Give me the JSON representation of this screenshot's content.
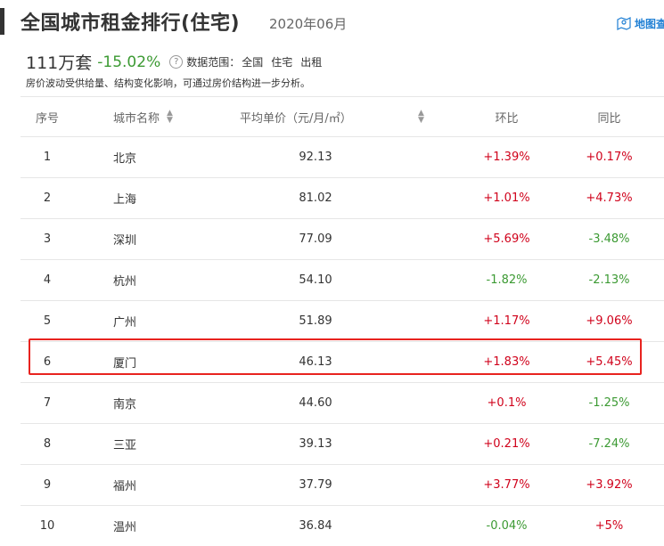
{
  "header": {
    "title": "全国城市租金排行(住宅)",
    "date": "2020年06月",
    "map_link": "地图查"
  },
  "summary": {
    "total": "111万套",
    "change": "-15.02%",
    "help_icon": "?",
    "scope_label": "数据范围：",
    "scope_region": "全国",
    "scope_type": "住宅",
    "scope_mode": "出租",
    "note": "房价波动受供给量、结构变化影响，可通过房价结构进一步分析。"
  },
  "table": {
    "columns": {
      "rank": "序号",
      "city": "城市名称",
      "price": "平均单价（元/月/㎡）",
      "mom": "环比",
      "yoy": "同比"
    },
    "rows": [
      {
        "rank": "1",
        "city": "北京",
        "price": "92.13",
        "mom": "+1.39%",
        "yoy": "+0.17%"
      },
      {
        "rank": "2",
        "city": "上海",
        "price": "81.02",
        "mom": "+1.01%",
        "yoy": "+4.73%"
      },
      {
        "rank": "3",
        "city": "深圳",
        "price": "77.09",
        "mom": "+5.69%",
        "yoy": "-3.48%"
      },
      {
        "rank": "4",
        "city": "杭州",
        "price": "54.10",
        "mom": "-1.82%",
        "yoy": "-2.13%"
      },
      {
        "rank": "5",
        "city": "广州",
        "price": "51.89",
        "mom": "+1.17%",
        "yoy": "+9.06%"
      },
      {
        "rank": "6",
        "city": "厦门",
        "price": "46.13",
        "mom": "+1.83%",
        "yoy": "+5.45%"
      },
      {
        "rank": "7",
        "city": "南京",
        "price": "44.60",
        "mom": "+0.1%",
        "yoy": "-1.25%"
      },
      {
        "rank": "8",
        "city": "三亚",
        "price": "39.13",
        "mom": "+0.21%",
        "yoy": "-7.24%"
      },
      {
        "rank": "9",
        "city": "福州",
        "price": "37.79",
        "mom": "+3.77%",
        "yoy": "+3.92%"
      },
      {
        "rank": "10",
        "city": "温州",
        "price": "36.84",
        "mom": "-0.04%",
        "yoy": "+5%"
      }
    ]
  },
  "colors": {
    "up": "#d0021b",
    "down": "#3c9a33",
    "highlight": "#e8231f",
    "link": "#1f7fd4"
  }
}
